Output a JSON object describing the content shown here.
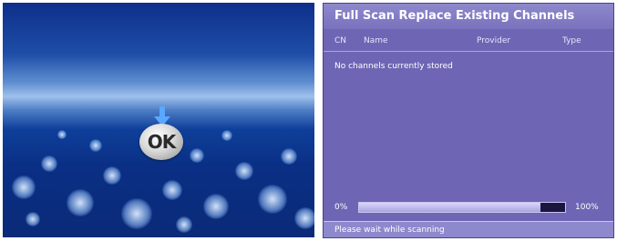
{
  "remote_illustration": {
    "ok_button_label": "OK",
    "arrow_icon": "arrow-down-icon"
  },
  "scan_screen": {
    "title": "Full Scan Replace Existing Channels",
    "columns": [
      "CN",
      "Name",
      "Provider",
      "Type"
    ],
    "empty_message": "No channels currently stored",
    "progress": {
      "min_label": "0%",
      "max_label": "100%",
      "value_fraction": 0.88
    },
    "status": "Please wait while scanning"
  },
  "colors": {
    "panel_background": "#6e66b4",
    "title_bar": "#8e88cc",
    "tv_background": "#0a2f84"
  }
}
